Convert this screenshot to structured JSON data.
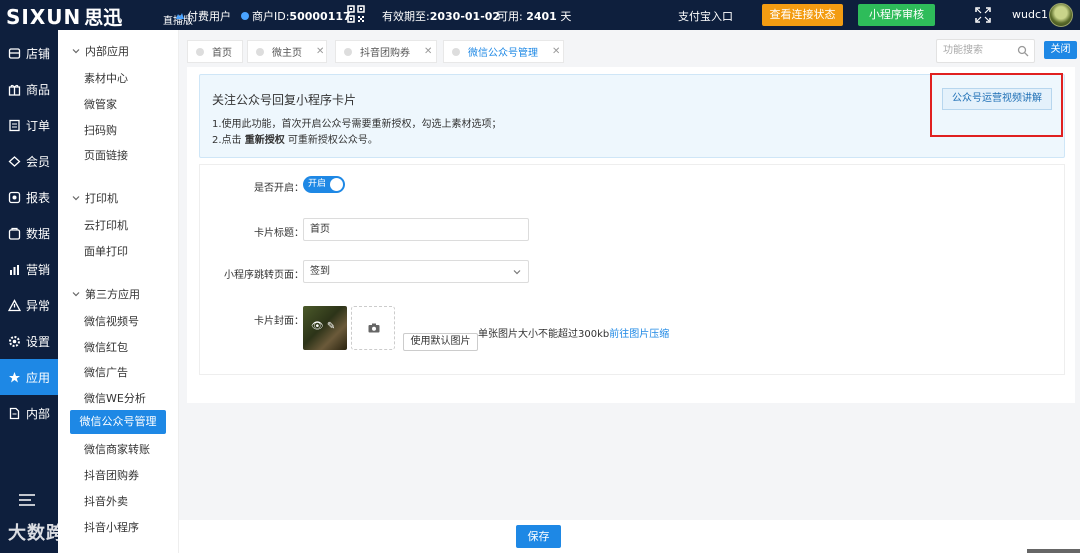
{
  "topbar": {
    "logo_en": "SIXUN",
    "logo_cn": "思迅",
    "live_tag": "直播版",
    "user_type": "付费用户",
    "merchant_label": "商户ID:",
    "merchant_id": "50000117",
    "valid_label": "有效期至:",
    "valid_date": "2030-01-02",
    "available_label": "可用:",
    "available_days": "2401",
    "days_unit": "天",
    "alipay_entry": "支付宝入口",
    "check_connection": "查看连接状态",
    "miniprogram_review": "小程序审核",
    "username": "wudc1"
  },
  "leftnav": {
    "items": [
      {
        "label": "店铺",
        "icon": "store-icon"
      },
      {
        "label": "商品",
        "icon": "gift-icon"
      },
      {
        "label": "订单",
        "icon": "order-icon"
      },
      {
        "label": "会员",
        "icon": "member-icon"
      },
      {
        "label": "报表",
        "icon": "report-icon"
      },
      {
        "label": "数据",
        "icon": "data-icon"
      },
      {
        "label": "营销",
        "icon": "marketing-icon"
      },
      {
        "label": "异常",
        "icon": "warning-icon"
      },
      {
        "label": "设置",
        "icon": "gear-icon"
      },
      {
        "label": "应用",
        "icon": "star-icon"
      },
      {
        "label": "内部",
        "icon": "document-icon"
      }
    ]
  },
  "subnav": {
    "group1": "内部应用",
    "group1_items": [
      "素材中心",
      "微管家",
      "扫码购",
      "页面链接"
    ],
    "group2": "打印机",
    "group2_items": [
      "云打印机",
      "面单打印"
    ],
    "group3": "第三方应用",
    "group3_items": [
      "微信视频号",
      "微信红包",
      "微信广告",
      "微信WE分析",
      "微信公众号管理",
      "微信商家转账",
      "抖音团购券",
      "抖音外卖",
      "抖音小程序"
    ]
  },
  "tabs": {
    "items": [
      "首页",
      "微主页",
      "抖音团购券",
      "微信公众号管理"
    ],
    "search_placeholder": "功能搜索",
    "close": "关闭"
  },
  "notice": {
    "title": "关注公众号回复小程序卡片",
    "line1": "1.使用此功能，首次开启公众号需要重新授权，勾选上素材选项；",
    "line2_prefix": "2.点击",
    "line2_bold": "重新授权",
    "line2_suffix": "可重新授权公众号。",
    "video_btn": "公众号运营视频讲解"
  },
  "form": {
    "enable_label": "是否开启：",
    "enable_value": "开启",
    "title_label": "卡片标题：",
    "title_value": "首页",
    "jump_label": "小程序跳转页面：",
    "jump_value": "签到",
    "cover_label": "卡片封面：",
    "default_img_btn": "使用默认图片",
    "hint_text": "单张图片大小不能超过300kb",
    "hint_link": "前往图片压缩"
  },
  "footer": {
    "save": "保存",
    "watermark": "大数跨境"
  },
  "colors": {
    "nav_bg": "#0e1f3d",
    "primary": "#1e88e5",
    "orange": "#f39c12",
    "green": "#2ebc5a",
    "highlight_red": "#e02020"
  }
}
